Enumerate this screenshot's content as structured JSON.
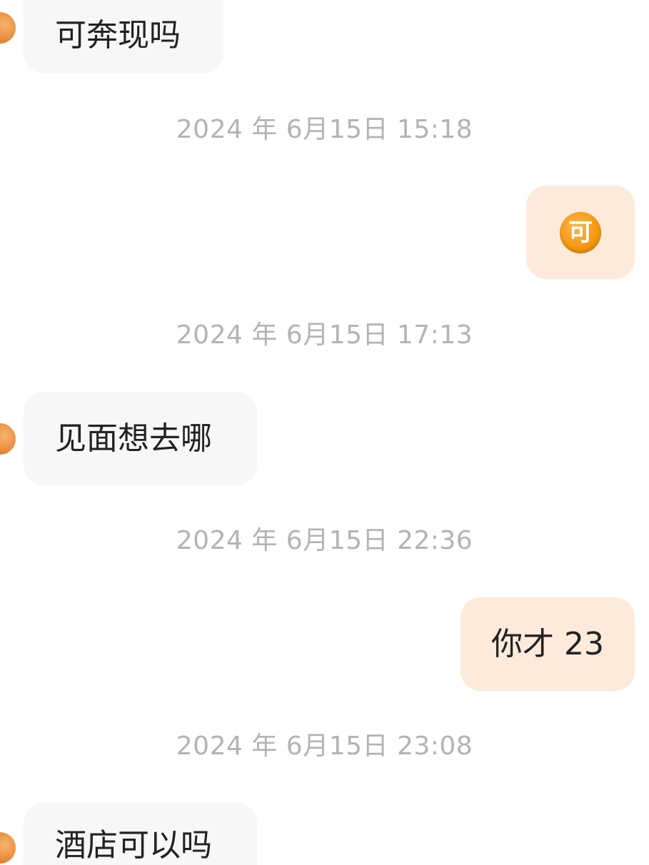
{
  "messages": [
    {
      "side": "incoming",
      "text": "可奔现吗"
    },
    {
      "timestamp": "2024 年 6月15日 15:18"
    },
    {
      "side": "outgoing",
      "emoji": "可"
    },
    {
      "timestamp": "2024 年 6月15日 17:13"
    },
    {
      "side": "incoming",
      "text": "见面想去哪"
    },
    {
      "timestamp": "2024 年 6月15日 22:36"
    },
    {
      "side": "outgoing",
      "text": "你才 23"
    },
    {
      "timestamp": "2024 年 6月15日 23:08"
    },
    {
      "side": "incoming",
      "text": "酒店可以吗"
    }
  ],
  "colors": {
    "incoming_bubble": "#f7f7f7",
    "outgoing_bubble": "#fdeadb",
    "timestamp_text": "#b3b3b3",
    "message_text": "#222222",
    "emoji_orange": "#f59a12"
  },
  "icons": {
    "avatar": "avatar",
    "emoji": "ke-emoji-icon"
  }
}
